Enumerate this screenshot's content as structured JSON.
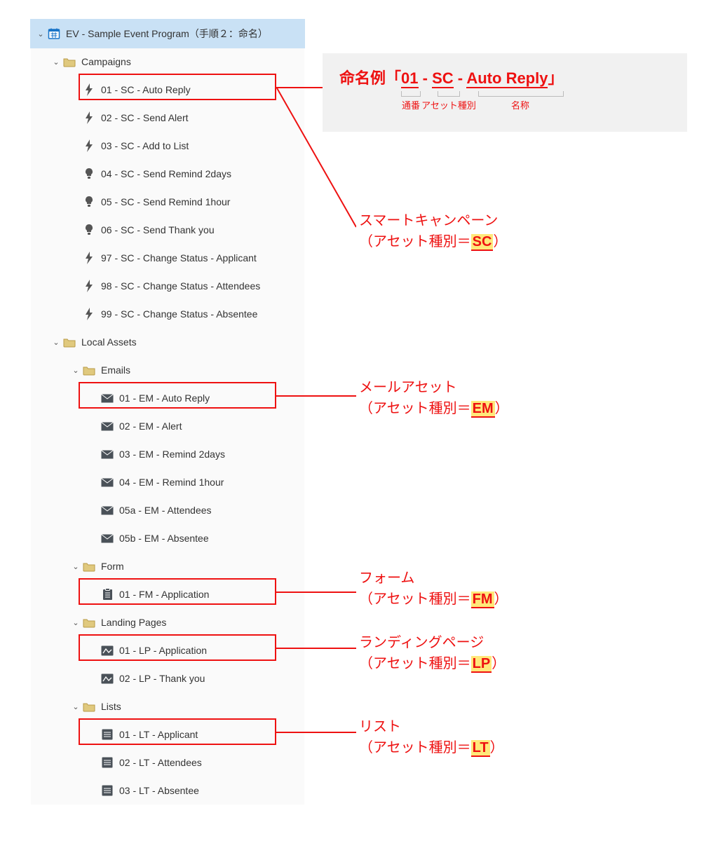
{
  "program": {
    "title": "EV - Sample Event Program（手順２：命名）"
  },
  "tree": {
    "campaigns": {
      "folder": "Campaigns",
      "items": [
        "01 - SC - Auto Reply",
        "02 - SC - Send Alert",
        "03 - SC - Add to List",
        "04 - SC - Send Remind 2days",
        "05 - SC - Send Remind 1hour",
        "06 - SC - Send Thank you",
        "97 - SC - Change Status - Applicant",
        "98 - SC - Change Status - Attendees",
        "99 - SC - Change Status - Absentee"
      ]
    },
    "local": {
      "folder": "Local Assets",
      "emails_folder": "Emails",
      "emails": [
        "01 - EM - Auto Reply",
        "02 - EM - Alert",
        "03 - EM - Remind 2days",
        "04 - EM - Remind 1hour",
        "05a - EM - Attendees",
        "05b - EM - Absentee"
      ],
      "form_folder": "Form",
      "forms": [
        "01 - FM - Application"
      ],
      "lp_folder": "Landing Pages",
      "lps": [
        "01 - LP - Application",
        "02 - LP - Thank you"
      ],
      "lists_folder": "Lists",
      "lists": [
        "01 - LT - Applicant",
        "02 - LT - Attendees",
        "03 - LT - Absentee"
      ]
    }
  },
  "callout": {
    "prefix": "命名例「",
    "p1": "01",
    "dash1": " - ",
    "p2": "SC",
    "dash2": " - ",
    "p3": "Auto Reply",
    "suffix": "」",
    "label1": "通番",
    "label2": "アセット種別",
    "label3": "名称"
  },
  "anno": {
    "sc_t": "スマートキャンペーン",
    "sc_b": "（アセット種別＝",
    "sc_c": "SC",
    "em_t": "メールアセット",
    "em_b": "（アセット種別＝",
    "em_c": "EM",
    "fm_t": "フォーム",
    "fm_b": "（アセット種別＝",
    "fm_c": "FM",
    "lp_t": "ランディングページ",
    "lp_b": "（アセット種別＝",
    "lp_c": "LP",
    "lt_t": "リスト",
    "lt_b": "（アセット種別＝",
    "lt_c": "LT",
    "close": "）"
  }
}
